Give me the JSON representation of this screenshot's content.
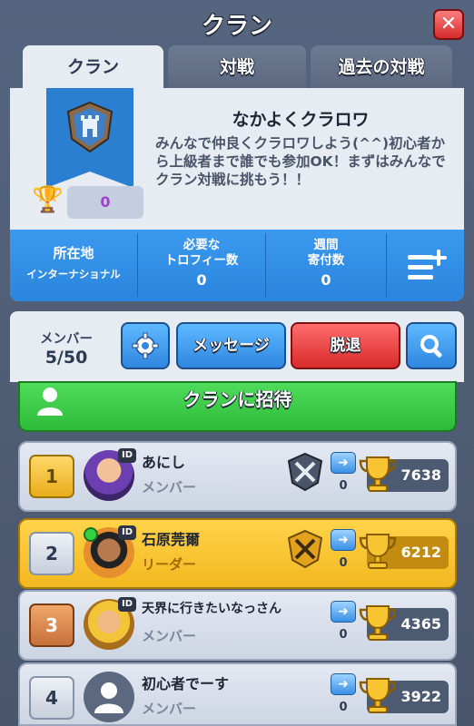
{
  "header": {
    "title": "クラン",
    "close_label": "✕"
  },
  "tabs": [
    {
      "label": "クラン",
      "active": true
    },
    {
      "label": "対戦",
      "active": false
    },
    {
      "label": "過去の対戦",
      "active": false
    }
  ],
  "clan": {
    "name": "なかよくクラロワ",
    "description": "みんなで仲良くクラロワしよう(^^)初心者から上級者まで誰でも参加OK！まずはみんなでクラン対戦に挑もう！！",
    "trophies": "0"
  },
  "stats": [
    {
      "label": "所在地",
      "value": "インターナショナル"
    },
    {
      "label": "必要な\nトロフィー数",
      "value": "0"
    },
    {
      "label": "週間\n寄付数",
      "value": "0"
    }
  ],
  "toolbar": {
    "members_label": "メンバー",
    "members_count": "5/50",
    "message_label": "メッセージ",
    "leave_label": "脱退"
  },
  "invite_label": "クランに招待",
  "members": [
    {
      "rank": "1",
      "name": "あにし",
      "role": "メンバー",
      "donations": "0",
      "trophies": "7638"
    },
    {
      "rank": "2",
      "name": "石原莞爾",
      "role": "リーダー",
      "donations": "0",
      "trophies": "6212"
    },
    {
      "rank": "3",
      "name": "天界に行きたいなっさん",
      "role": "メンバー",
      "donations": "0",
      "trophies": "4365"
    },
    {
      "rank": "4",
      "name": "初心者でーす",
      "role": "メンバー",
      "donations": "0",
      "trophies": "3922"
    }
  ],
  "colors": {
    "accent_blue": "#2b84dd",
    "invite_green": "#2fbb3a",
    "leave_red": "#d92b2b",
    "leader_gold": "#f2b81f"
  }
}
